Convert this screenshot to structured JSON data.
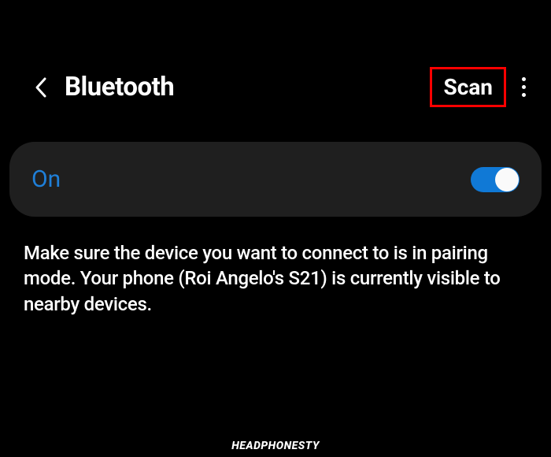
{
  "header": {
    "title": "Bluetooth",
    "scan_label": "Scan"
  },
  "toggle": {
    "label": "On",
    "state": "on"
  },
  "help_text": "Make sure the device you want to connect to is in pairing mode. Your phone (Roi Angelo's S21) is currently visible to nearby devices.",
  "watermark": "HEADPHONESTY"
}
